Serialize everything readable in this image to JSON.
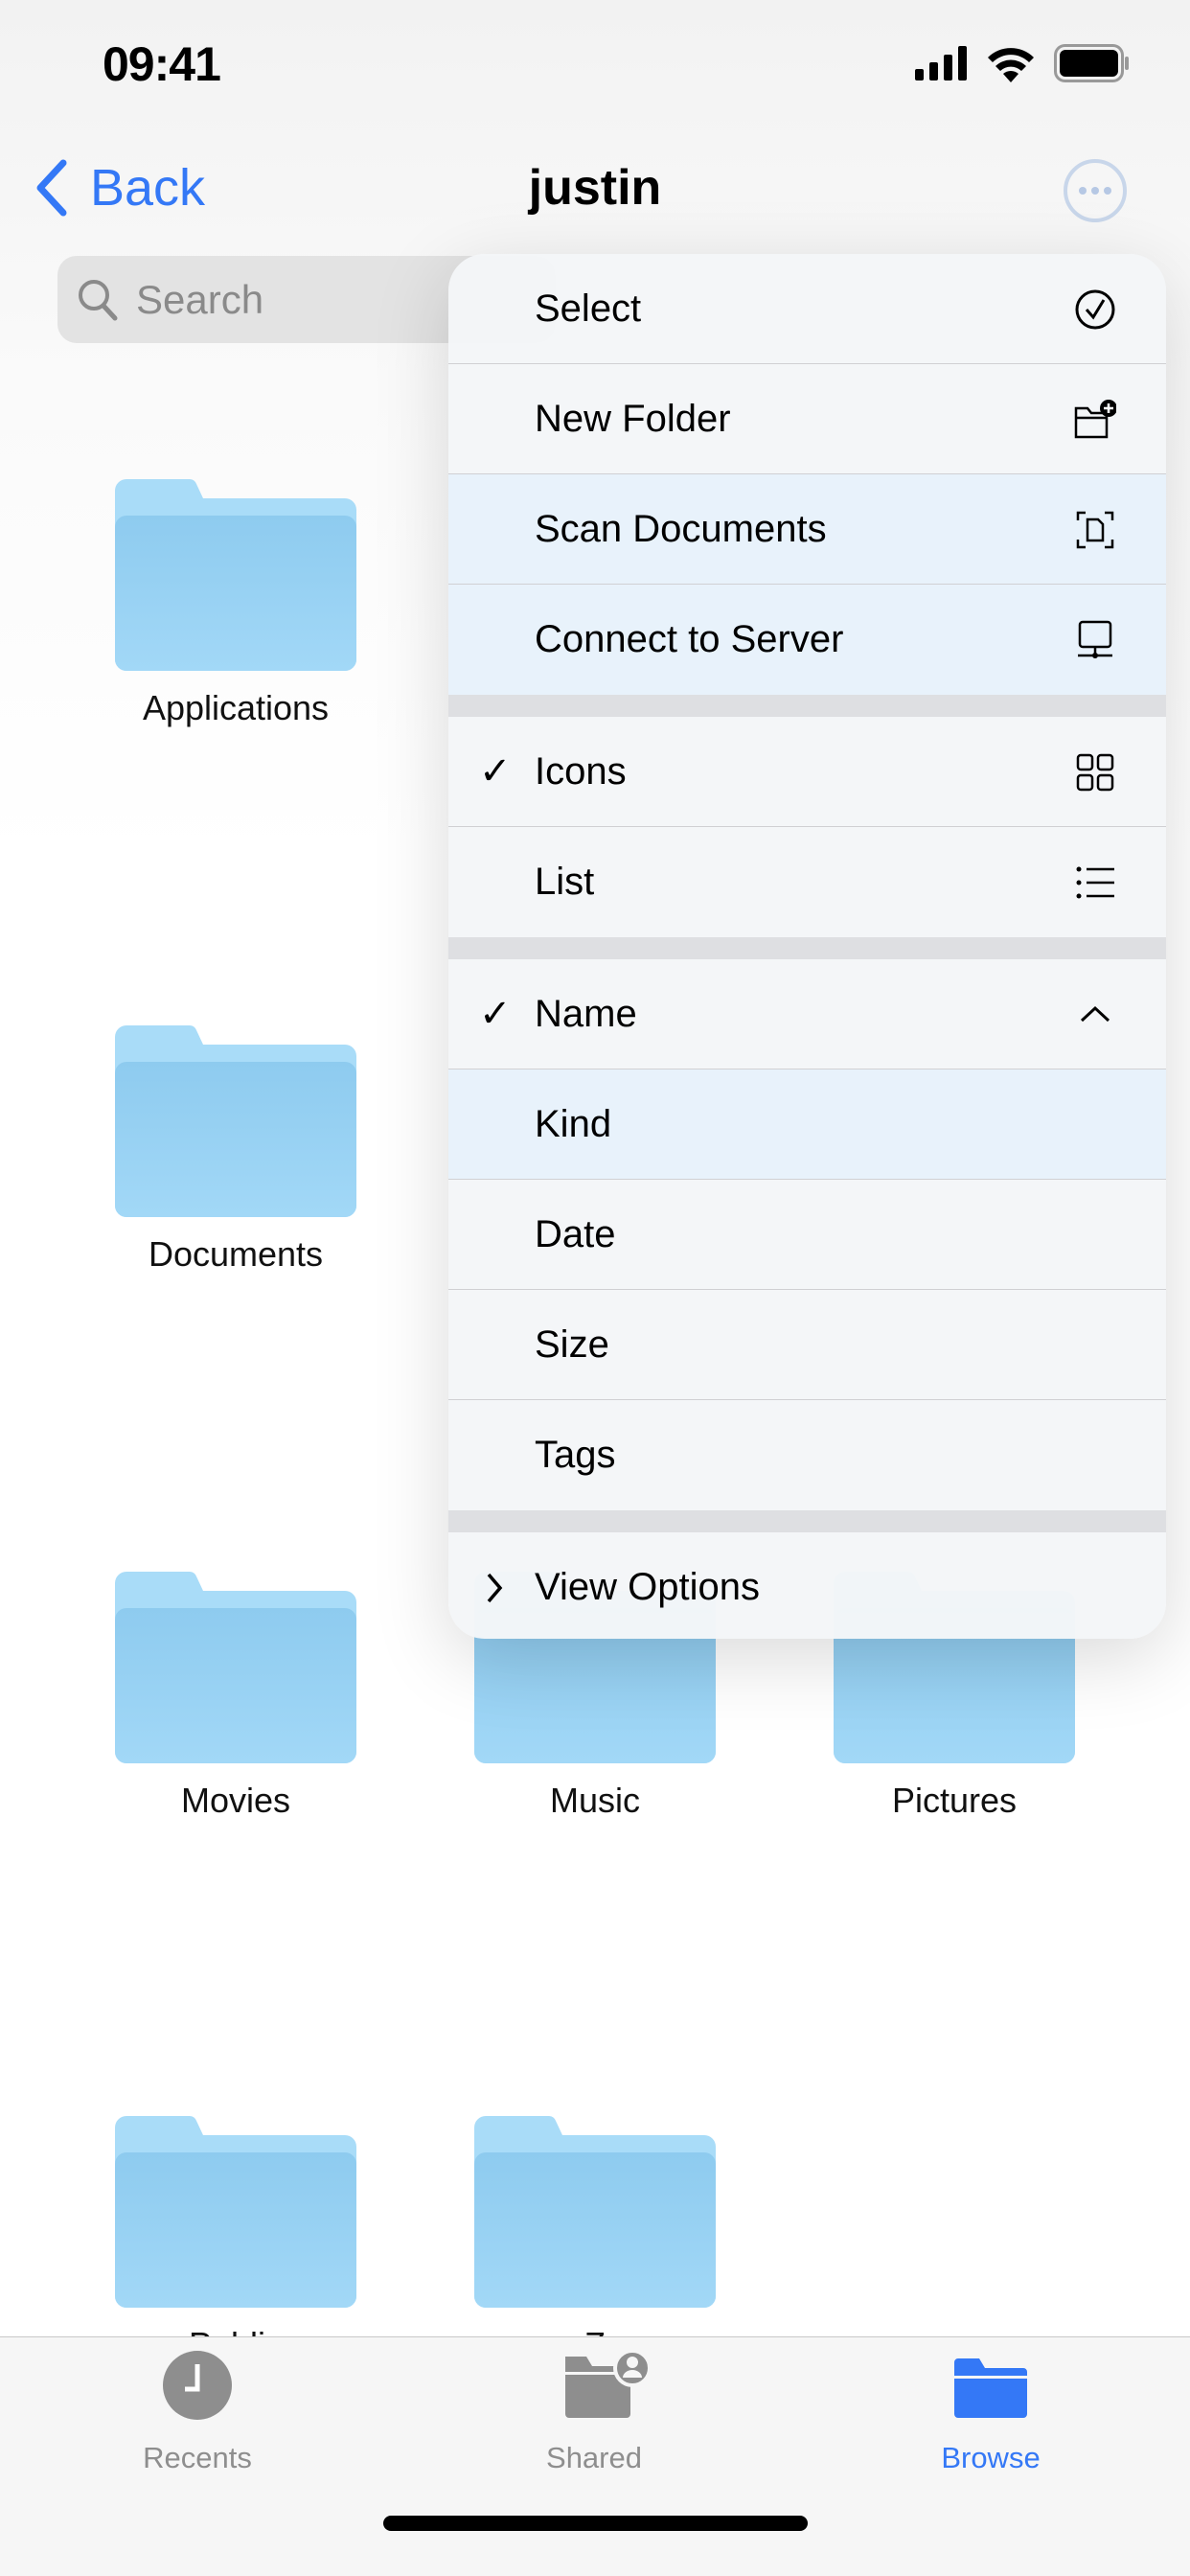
{
  "status": {
    "time": "09:41"
  },
  "nav": {
    "back_label": "Back",
    "title": "justin"
  },
  "search": {
    "placeholder": "Search"
  },
  "folders": [
    "Applications",
    "Documents",
    "Movies",
    "Music",
    "Pictures",
    "Public",
    "Z"
  ],
  "menu": {
    "groups": [
      [
        {
          "label": "Select",
          "icon": "checkmark-circle-icon",
          "checked": false
        },
        {
          "label": "New Folder",
          "icon": "folder-badge-plus-icon",
          "checked": false
        },
        {
          "label": "Scan Documents",
          "icon": "doc-viewfinder-icon",
          "checked": false
        },
        {
          "label": "Connect to Server",
          "icon": "server-display-icon",
          "checked": false
        }
      ],
      [
        {
          "label": "Icons",
          "icon": "grid-icon",
          "checked": true
        },
        {
          "label": "List",
          "icon": "list-bullet-icon",
          "checked": false
        }
      ],
      [
        {
          "label": "Name",
          "icon": "chevron-up-icon",
          "checked": true
        },
        {
          "label": "Kind",
          "checked": false
        },
        {
          "label": "Date",
          "checked": false
        },
        {
          "label": "Size",
          "checked": false
        },
        {
          "label": "Tags",
          "checked": false
        }
      ],
      [
        {
          "label": "View Options",
          "icon": "chevron-right-icon"
        }
      ]
    ],
    "checkmark": "✓"
  },
  "tabs": [
    {
      "label": "Recents",
      "icon": "clock-icon"
    },
    {
      "label": "Shared",
      "icon": "shared-folder-icon"
    },
    {
      "label": "Browse",
      "icon": "folder-icon",
      "active": true
    }
  ],
  "colors": {
    "accent": "#3478f6",
    "folder": "#9dd3f5",
    "inactive_tab": "#8e8e8e"
  }
}
